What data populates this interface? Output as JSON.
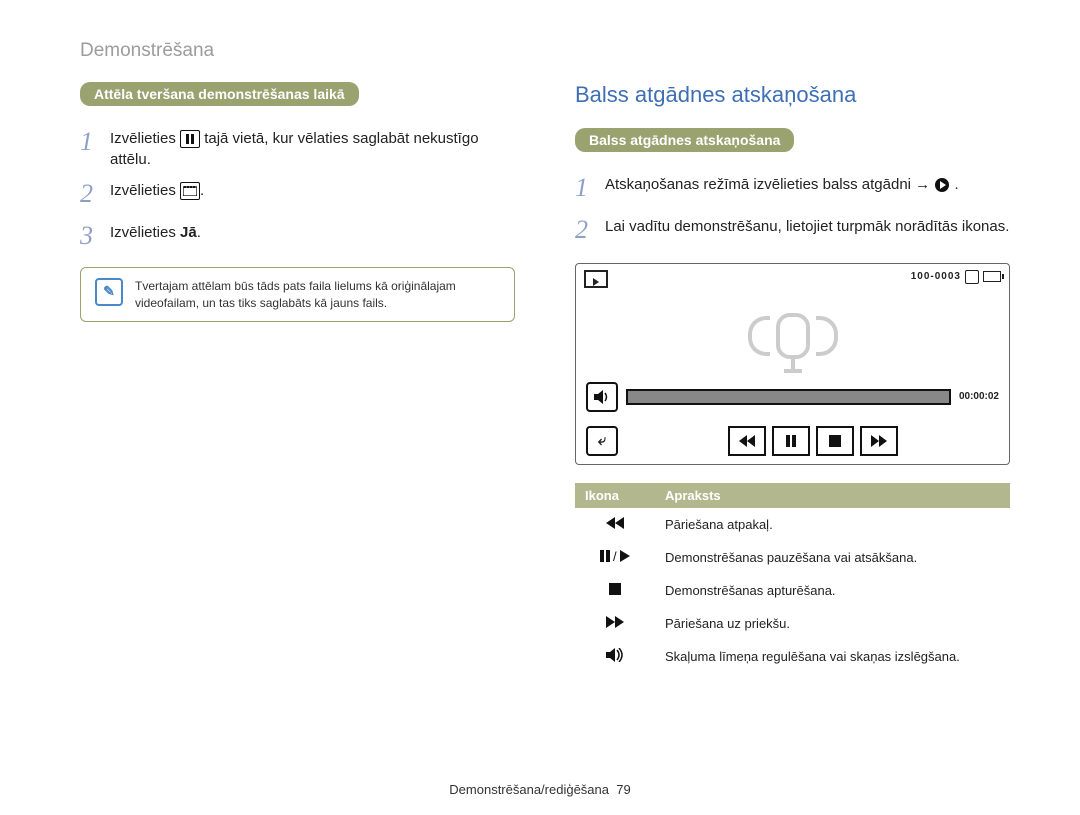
{
  "breadcrumb": "Demonstrēšana",
  "left": {
    "bar": "Attēla tveršana demonstrēšanas laikā",
    "step1_a": "Izvēlieties ",
    "step1_b": " tajā vietā, kur vēlaties saglabāt nekustīgo attēlu.",
    "step2": "Izvēlieties ",
    "step3_a": "Izvēlieties ",
    "step3_b": "Jā",
    "note": "Tvertajam attēlam būs tāds pats faila lielums kā oriģinālajam videofailam, un tas tiks saglabāts kā jauns fails."
  },
  "right": {
    "title": "Balss atgādnes atskaņošana",
    "bar": "Balss atgādnes atskaņošana",
    "step1": "Atskaņošanas režīmā izvēlieties balss atgādni → ",
    "step2": "Lai vadītu demonstrēšanu, lietojiet turpmāk norādītās ikonas.",
    "preview": {
      "counter": "100-0003",
      "time": "00:00:02"
    },
    "table": {
      "h_icon": "Ikona",
      "h_desc": "Apraksts",
      "rows": [
        {
          "icon": "rewind",
          "desc": "Pāriešana atpakaļ."
        },
        {
          "icon": "pauseplay",
          "desc": "Demonstrēšanas pauzēšana vai atsākšana."
        },
        {
          "icon": "stop",
          "desc": "Demonstrēšanas apturēšana."
        },
        {
          "icon": "forward",
          "desc": "Pāriešana uz priekšu."
        },
        {
          "icon": "volume",
          "desc": "Skaļuma līmeņa regulēšana vai skaņas izslēgšana."
        }
      ]
    }
  },
  "footer": {
    "text": "Demonstrēšana/rediģēšana",
    "page": "79"
  }
}
